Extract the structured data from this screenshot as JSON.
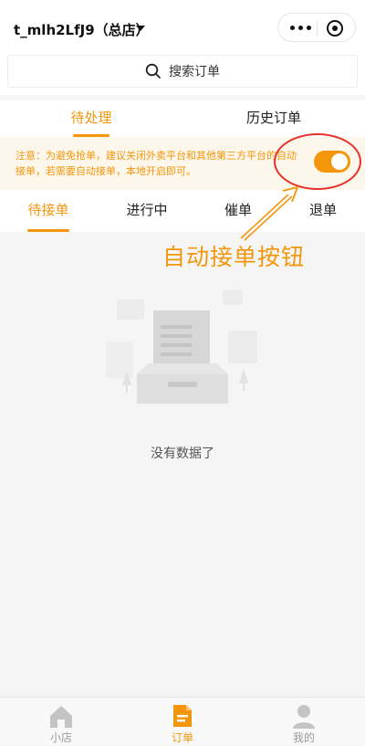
{
  "header": {
    "store_name": "t_mlh2LfJ9（总店）",
    "more_icon": "more-dots-icon",
    "close_icon": "target-close-icon"
  },
  "search": {
    "placeholder": "搜索订单",
    "icon": "search-icon"
  },
  "main_tabs": [
    {
      "label": "待处理",
      "active": true
    },
    {
      "label": "历史订单",
      "active": false
    }
  ],
  "notice": {
    "text": "注意：为避免抢单，建议关闭外卖平台和其他第三方平台的自动接单，若需要自动接单，本地开启即可。",
    "auto_accept_on": true
  },
  "sub_tabs": [
    {
      "label": "待接单",
      "active": true
    },
    {
      "label": "进行中",
      "active": false
    },
    {
      "label": "催单",
      "active": false
    },
    {
      "label": "退单",
      "active": false
    }
  ],
  "annotation": {
    "label": "自动接单按钮"
  },
  "empty_state": {
    "text": "没有数据了"
  },
  "bottom_nav": [
    {
      "label": "小店",
      "icon": "home-icon",
      "active": false
    },
    {
      "label": "订单",
      "icon": "order-document-icon",
      "active": true
    },
    {
      "label": "我的",
      "icon": "user-icon",
      "active": false
    }
  ],
  "colors": {
    "accent": "#f3960c",
    "notice_bg": "#fdf6ea",
    "annotation_ring": "#e8302a"
  }
}
